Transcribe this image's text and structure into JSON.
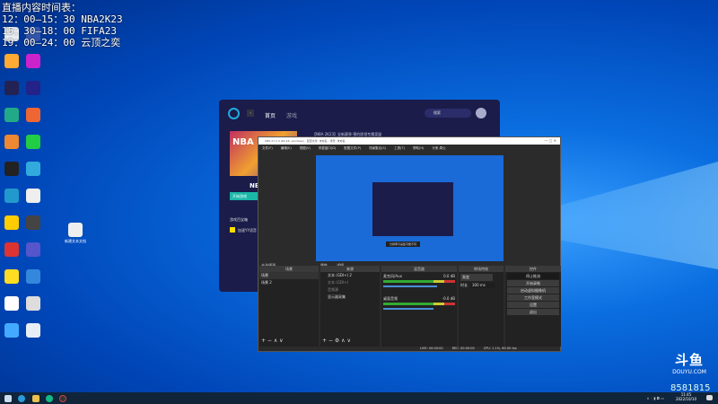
{
  "schedule": {
    "title": "直播内容时间表：",
    "lines": [
      "12：00—15：30 NBA2K23",
      "15：30—18：00 FIFA23",
      "19：00—24：00 云顶之奕"
    ]
  },
  "launcher": {
    "nav_back": "‹",
    "tabs": [
      "首页",
      "游戏"
    ],
    "search_placeholder": "搜索",
    "game_title": "NBA",
    "game_banner": "NBA",
    "launch_button": "开始游戏",
    "guide_heading": "游戏百宝箱",
    "guide_item": "加速YY语音",
    "headline": "【NBA 2K23】全新赛季·预约即领专属奖励"
  },
  "obs": {
    "title": "OBS 27.2.4 (64-bit, windows) - 配置文件: 未命名 - 场景: 未命名",
    "menu": [
      "文件(F)",
      "编辑(E)",
      "视图(V)",
      "停靠窗口(D)",
      "配置文件(P)",
      "场景集合(S)",
      "工具(T)",
      "帮助(H)",
      "头条-周公"
    ],
    "preview_caption": "分辨率与采集可能不同",
    "source_bar": [
      "属性",
      "滤镜"
    ],
    "no_source": "未选择源",
    "docks": {
      "scenes": "场景",
      "sources": "来源",
      "mixer": "混音器",
      "transitions": "转场特效",
      "controls": "控件"
    },
    "scenes": [
      "场景",
      "场景 2"
    ],
    "sources": [
      "文本 (GDI+) 2",
      "文本 (GDI+)",
      "音频源",
      "显示器采集"
    ],
    "mixer": [
      {
        "name": "麦克风/Aux",
        "db": "0.0 dB"
      },
      {
        "name": "桌面音频",
        "db": "-0.0 dB"
      }
    ],
    "transition": {
      "type": "渐变",
      "duration_label": "时长",
      "duration": "300 ms"
    },
    "controls": [
      "停止推流",
      "开始录制",
      "启动虚拟摄像机",
      "工作室模式",
      "设置",
      "退出"
    ],
    "status": {
      "live": "LIVE: 00:00:00",
      "rec": "REC: 00:00:00",
      "cpu": "CPU: 1.1%, 60.00 fps"
    }
  },
  "desktop_file": "新建文本文档",
  "douyu": {
    "logo": "斗鱼",
    "site": "DOUYU.COM",
    "room": "8581815"
  },
  "clock": {
    "time": "11:45",
    "date": "2022/10/10"
  }
}
